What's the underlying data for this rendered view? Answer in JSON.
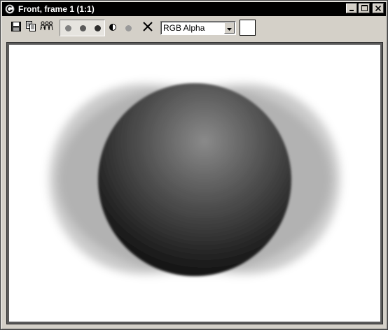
{
  "window": {
    "title": "Front, frame 1 (1:1)",
    "app_icon": "3ds-max-logo-icon"
  },
  "title_buttons": [
    {
      "name": "minimize-button",
      "icon": "minimize-icon"
    },
    {
      "name": "maximize-button",
      "icon": "maximize-icon"
    },
    {
      "name": "close-button",
      "icon": "close-icon"
    }
  ],
  "toolbar": {
    "tools": [
      {
        "name": "save-image-button",
        "icon": "floppy-disk-icon"
      },
      {
        "name": "copy-image-button",
        "icon": "copy-icon"
      },
      {
        "name": "clone-window-button",
        "icon": "clone-people-icon"
      }
    ],
    "channel_buttons": [
      {
        "name": "red-channel-button",
        "icon": "red-channel-dot-icon",
        "active": true
      },
      {
        "name": "green-channel-button",
        "icon": "green-channel-dot-icon",
        "active": true
      },
      {
        "name": "blue-channel-button",
        "icon": "blue-channel-dot-icon",
        "active": true
      },
      {
        "name": "alpha-channel-button",
        "icon": "half-circle-alpha-icon",
        "active": false
      },
      {
        "name": "monochrome-button",
        "icon": "gray-dot-icon",
        "active": false
      }
    ],
    "clear_icon": "x-clear-icon",
    "channel_select": {
      "value": "RGB Alpha",
      "options": [
        "RGB Alpha"
      ]
    },
    "swatch_color": "#ffffff"
  },
  "colors": {
    "titlebar_bg": "#000000",
    "window_bg": "#d4d0c8",
    "viewport_bg": "#ffffff"
  }
}
